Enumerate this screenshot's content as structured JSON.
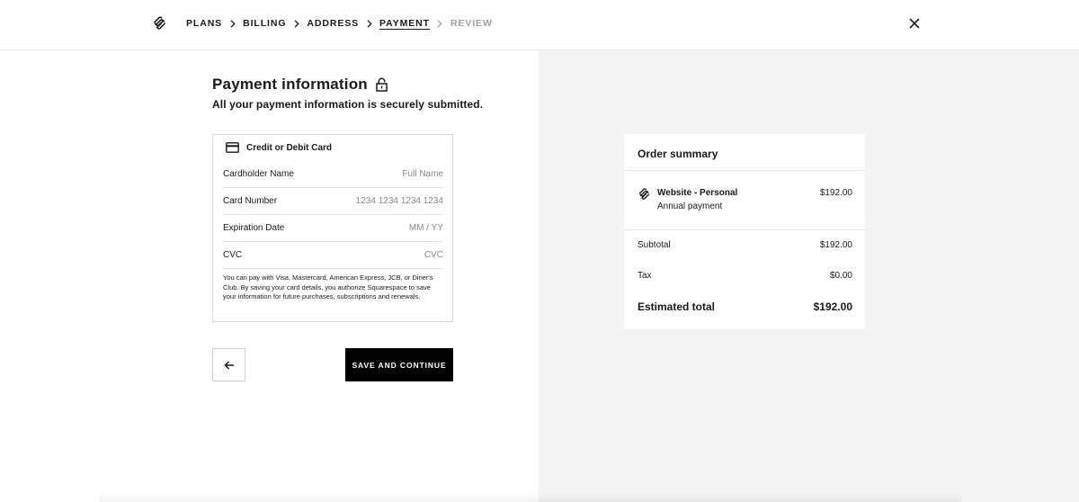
{
  "breadcrumbs": [
    {
      "label": "PLANS",
      "state": "done"
    },
    {
      "label": "BILLING",
      "state": "done"
    },
    {
      "label": "ADDRESS",
      "state": "done"
    },
    {
      "label": "PAYMENT",
      "state": "active"
    },
    {
      "label": "REVIEW",
      "state": "disabled"
    }
  ],
  "page": {
    "title": "Payment information",
    "subtitle": "All your payment information is securely submitted."
  },
  "card_form": {
    "heading": "Credit or Debit Card",
    "fields": [
      {
        "label": "Cardholder Name",
        "placeholder": "Full Name",
        "value": ""
      },
      {
        "label": "Card Number",
        "placeholder": "1234 1234 1234 1234",
        "value": ""
      },
      {
        "label": "Expiration Date",
        "placeholder": "MM / YY",
        "value": ""
      },
      {
        "label": "CVC",
        "placeholder": "CVC",
        "value": ""
      }
    ],
    "note": "You can pay with Visa, Mastercard, American Express, JCB, or Diner's Club. By saving your card details, you authorize Squarespace to save your information for future purchases, subscriptions and renewals."
  },
  "actions": {
    "save_label": "SAVE AND CONTINUE"
  },
  "summary": {
    "title": "Order summary",
    "item_name": "Website - Personal",
    "item_sub": "Annual payment",
    "item_price": "$192.00",
    "subtotal_label": "Subtotal",
    "subtotal": "$192.00",
    "tax_label": "Tax",
    "tax": "$0.00",
    "total_label": "Estimated total",
    "total": "$192.00"
  },
  "colors": {
    "accent": "#000000",
    "panel_bg": "#f4f4f4",
    "disabled_text": "#a0a0a0"
  },
  "icons": [
    "squarespace-logo-icon",
    "chevron-right-icon",
    "close-icon",
    "lock-icon",
    "credit-card-icon",
    "arrow-left-icon"
  ]
}
